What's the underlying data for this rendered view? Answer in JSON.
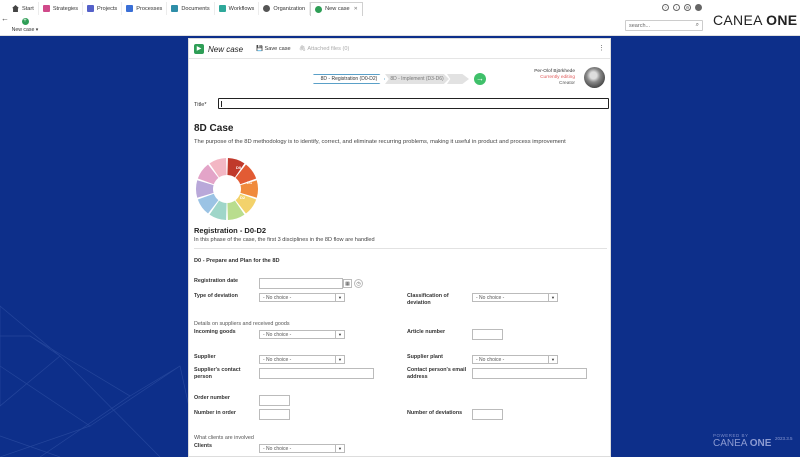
{
  "tabs": [
    {
      "label": "Start",
      "icon": "home-icon",
      "color": "#444444"
    },
    {
      "label": "Strategies",
      "icon": "strategies-icon",
      "color": "#d04a8a"
    },
    {
      "label": "Projects",
      "icon": "projects-icon",
      "color": "#5561c9"
    },
    {
      "label": "Processes",
      "icon": "processes-icon",
      "color": "#3a6fd6"
    },
    {
      "label": "Documents",
      "icon": "documents-icon",
      "color": "#2e8ea8"
    },
    {
      "label": "Workflows",
      "icon": "workflows-icon",
      "color": "#2ea89a"
    },
    {
      "label": "Organization",
      "icon": "organization-icon",
      "color": "#555555"
    },
    {
      "label": "New case",
      "icon": "case-icon",
      "color": "#2e9e56"
    }
  ],
  "toolbar": {
    "new_case_label": "New case"
  },
  "search": {
    "placeholder": "search..."
  },
  "brand": {
    "name_light": "CANEA ",
    "name_bold": "ONE"
  },
  "footer": {
    "powered_by": "POWERED BY",
    "name_light": "CANEA ",
    "name_bold": "ONE",
    "version": "2023.3.5"
  },
  "panel": {
    "title": "New case",
    "save_label": "Save case",
    "attached_label": "Attached files (0)"
  },
  "steps": {
    "current": "8D - Registration (D0-D2)",
    "next": "8D - Implement (D3-D6)"
  },
  "creator": {
    "name": "Per-Olof Björkhede",
    "status": "Currently editing",
    "role": "Creator"
  },
  "form": {
    "title_label": "Title*",
    "section_title": "8D Case",
    "section_desc": "The purpose of the 8D methodology is to identify, correct, and eliminate recurring problems, making it useful in product and process improvement",
    "phase_title": "Registration - D0-D2",
    "phase_desc": "In this phase of the case, the first 3 disciplines in the 8D flow are handled",
    "d0_title": "D0 - Prepare and Plan for the 8D",
    "registration_date": "Registration date",
    "type_of_deviation": "Type of deviation",
    "classification_of_deviation": "Classification of deviation",
    "suppliers_group": "Details on suppliers and received goods",
    "incoming_goods": "Incoming goods",
    "article_number": "Article number",
    "supplier": "Supplier",
    "supplier_plant": "Supplier plant",
    "suppliers_contact": "Supplier's contact person",
    "contact_email": "Contact person's email address",
    "order_number": "Order number",
    "number_in_order": "Number in order",
    "number_of_deviations": "Number of deviations",
    "clients_group": "What clients are involved",
    "clients": "Clients",
    "no_choice": "- No choice -"
  },
  "wheel": {
    "labels": [
      "D0",
      "D1",
      "D2"
    ],
    "colors": [
      "#c0392b",
      "#e25b34",
      "#f08a3c",
      "#f3d26b",
      "#b9dd8e",
      "#9fd6c9",
      "#9bc3e4",
      "#b9a8d9",
      "#e3a4c8",
      "#f3b7c4"
    ]
  },
  "colors": {
    "accent": "#2e9e56",
    "background": "#0d2f8a",
    "editing": "#e05a5a"
  }
}
